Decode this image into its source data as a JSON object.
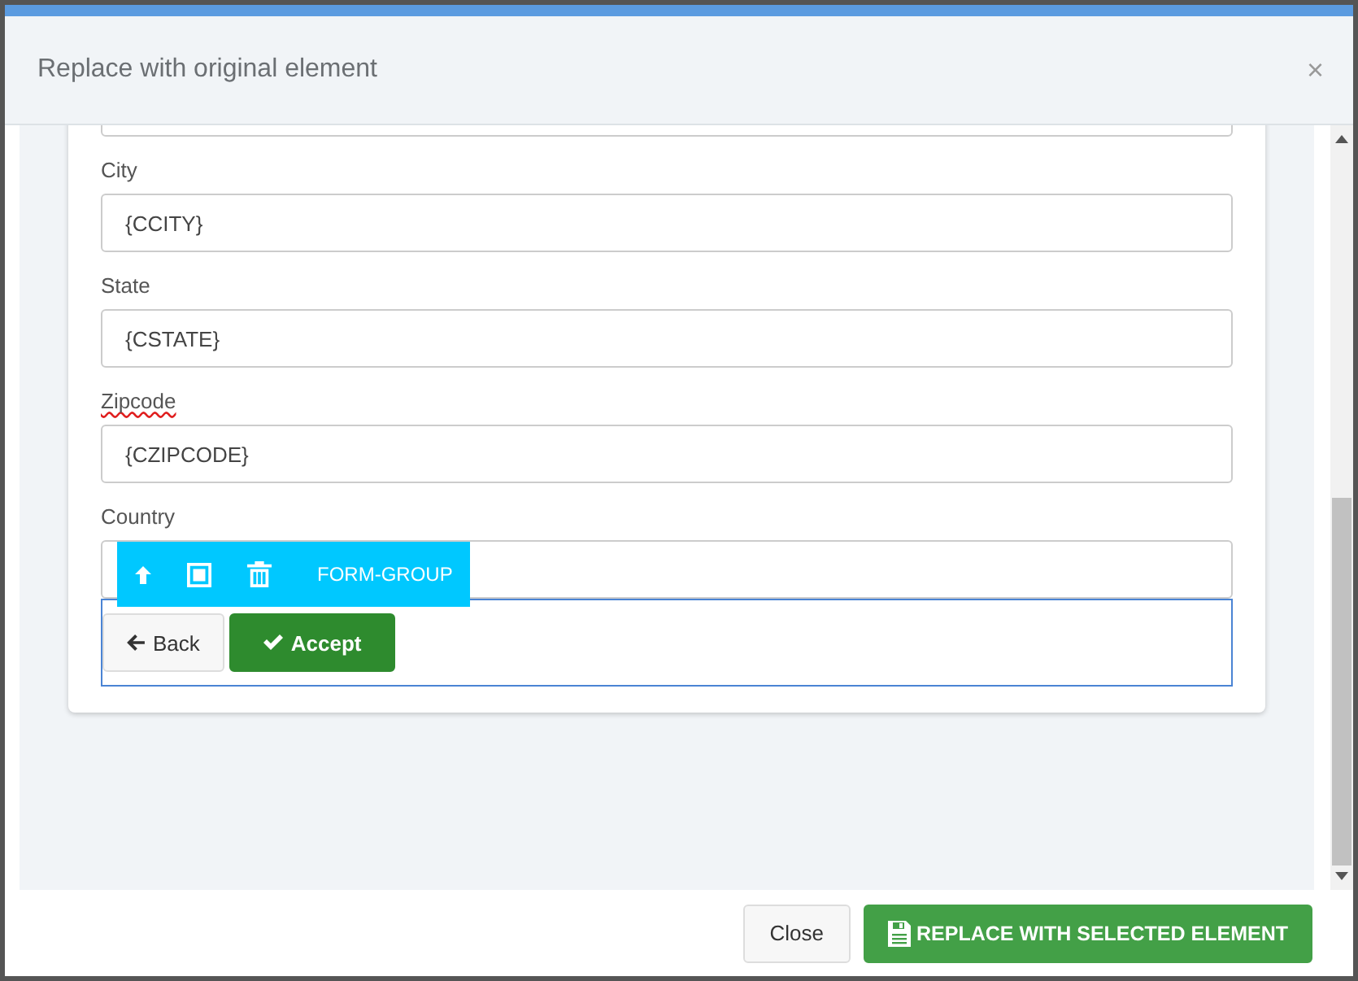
{
  "dialog": {
    "title": "Replace with original element",
    "close_glyph": "×"
  },
  "fields": [
    {
      "kind": "bare"
    },
    {
      "kind": "labeled",
      "label": "City",
      "value": "{CCITY}",
      "misspelled": false
    },
    {
      "kind": "labeled",
      "label": "State",
      "value": "{CSTATE}",
      "misspelled": false
    },
    {
      "kind": "labeled",
      "label": "Zipcode",
      "value": "{CZIPCODE}",
      "misspelled": true
    },
    {
      "kind": "labeled",
      "label": "Country",
      "misspelled": false
    }
  ],
  "element_toolbar": {
    "label": "FORM-GROUP"
  },
  "selected_group": {
    "buttons": [
      {
        "label": "Back",
        "kind": "back"
      },
      {
        "label": "Accept",
        "kind": "accept"
      }
    ]
  },
  "footer": {
    "buttons": [
      {
        "label": "Close",
        "kind": "default"
      },
      {
        "label": "REPLACE WITH SELECTED ELEMENT",
        "kind": "save"
      }
    ]
  }
}
